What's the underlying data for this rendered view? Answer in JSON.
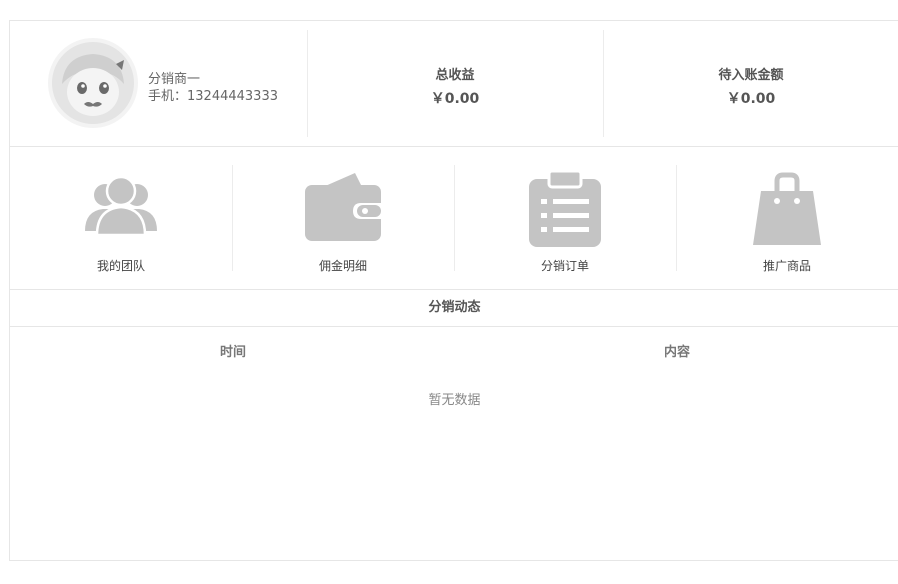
{
  "profile": {
    "avatar_icon": "cartoon-avatar-icon",
    "name": "分销商一",
    "phone": "手机：13244443333"
  },
  "stats": [
    {
      "label": "总收益",
      "value": "￥0.00"
    },
    {
      "label": "待入账金额",
      "value": "￥0.00"
    }
  ],
  "menu": [
    {
      "label": "我的团队",
      "icon": "team-icon"
    },
    {
      "label": "佣金明细",
      "icon": "wallet-icon"
    },
    {
      "label": "分销订单",
      "icon": "clipboard-icon"
    },
    {
      "label": "推广商品",
      "icon": "shopping-bag-icon"
    }
  ],
  "activity": {
    "title": "分销动态",
    "columns": [
      "时间",
      "内容"
    ],
    "empty_text": "暂无数据"
  },
  "colors": {
    "icon_gray": "#c4c4c4",
    "border": "#e6e6e6",
    "text": "#555555"
  }
}
